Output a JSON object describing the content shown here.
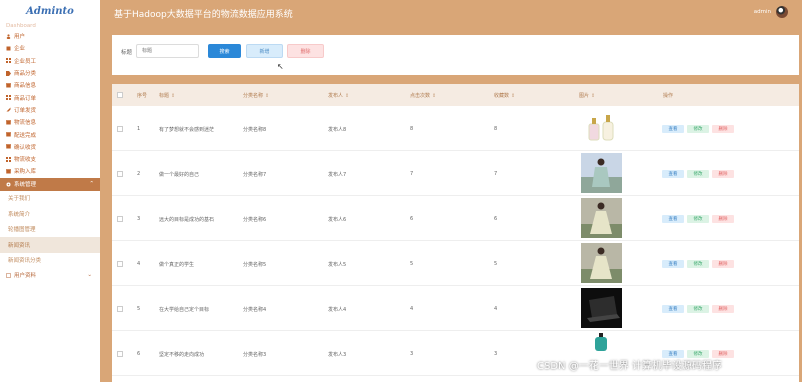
{
  "app": {
    "logo": "Adminto",
    "title": "基于Hadoop大数据平台的物流数据应用系统",
    "username": "admin"
  },
  "sidebar": {
    "faded_item": "Dashboard",
    "items": [
      {
        "label": "用户",
        "icon": "user-icon"
      },
      {
        "label": "企业",
        "icon": "building-icon"
      },
      {
        "label": "企业员工",
        "icon": "grid-icon"
      },
      {
        "label": "商品分类",
        "icon": "tag-icon"
      },
      {
        "label": "商品信息",
        "icon": "box-icon"
      },
      {
        "label": "商品订单",
        "icon": "grid-icon"
      },
      {
        "label": "订单发货",
        "icon": "truck-icon"
      },
      {
        "label": "物流信息",
        "icon": "box-icon"
      },
      {
        "label": "配送完成",
        "icon": "box-icon"
      },
      {
        "label": "确认收货",
        "icon": "box-icon"
      },
      {
        "label": "物流收支",
        "icon": "grid-icon"
      },
      {
        "label": "采购入库",
        "icon": "box-icon"
      }
    ],
    "active": {
      "label": "系统管理",
      "icon": "gear-icon"
    },
    "sub_items": [
      "关于我们",
      "系统简介",
      "轮播图管理",
      "新闻资讯",
      "新闻资讯分类"
    ],
    "selected_sub_index": 3,
    "user_menu": {
      "label": "用户资料"
    }
  },
  "search": {
    "label": "标题",
    "placeholder": "标题",
    "search_btn": "搜索",
    "add_btn": "新增",
    "delete_btn": "删除"
  },
  "table": {
    "columns": [
      {
        "label": "序号",
        "sortable": false
      },
      {
        "label": "标题",
        "sortable": true
      },
      {
        "label": "分类名称",
        "sortable": true
      },
      {
        "label": "发布人",
        "sortable": true
      },
      {
        "label": "点击次数",
        "sortable": true
      },
      {
        "label": "收藏数",
        "sortable": true
      },
      {
        "label": "图片",
        "sortable": true
      },
      {
        "label": "操作",
        "sortable": false
      }
    ],
    "sort_glyph": "⇕",
    "rows": [
      {
        "index": "1",
        "title": "有了梦想就不会感到迷茫",
        "category": "分类名称8",
        "publisher": "发布人8",
        "clicks": "8",
        "favorites": "8",
        "image": "perfume"
      },
      {
        "index": "2",
        "title": "做一个最好的自己",
        "category": "分类名称7",
        "publisher": "发布人7",
        "clicks": "7",
        "favorites": "7",
        "image": "girl-outdoor"
      },
      {
        "index": "3",
        "title": "远大的目标是成功的基石",
        "category": "分类名称6",
        "publisher": "发布人6",
        "clicks": "6",
        "favorites": "6",
        "image": "girl-dress"
      },
      {
        "index": "4",
        "title": "做个真正的学生",
        "category": "分类名称5",
        "publisher": "发布人5",
        "clicks": "5",
        "favorites": "5",
        "image": "girl-dress"
      },
      {
        "index": "5",
        "title": "在大学给自己定个目标",
        "category": "分类名称4",
        "publisher": "发布人4",
        "clicks": "4",
        "favorites": "4",
        "image": "laptop"
      },
      {
        "index": "6",
        "title": "坚定不移的走向成功",
        "category": "分类名称3",
        "publisher": "发布人3",
        "clicks": "3",
        "favorites": "3",
        "image": "perfume-blue"
      }
    ],
    "actions": {
      "view": "查看",
      "edit": "修改",
      "delete": "删除"
    }
  },
  "watermark": "CSDN @一花一世界 计算机毕设源码程序"
}
